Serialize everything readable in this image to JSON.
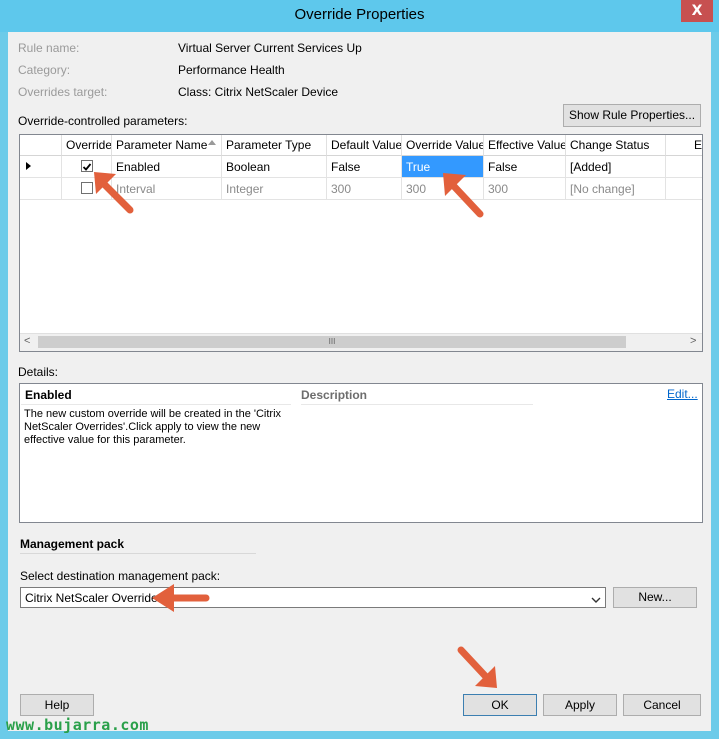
{
  "window": {
    "title": "Override Properties",
    "close_glyph": "X"
  },
  "rule": {
    "rule_name_label": "Rule name:",
    "rule_name_value": "Virtual Server Current Services Up",
    "category_label": "Category:",
    "category_value": "Performance Health",
    "target_label": "Overrides target:",
    "target_value": "Class: Citrix NetScaler Device"
  },
  "params_label": "Override-controlled parameters:",
  "show_rule_props_button": "Show Rule Properties...",
  "grid": {
    "columns": [
      "Override",
      "Parameter Name",
      "Parameter Type",
      "Default Value",
      "Override Value",
      "Effective Value",
      "Change Status",
      "En"
    ],
    "rows": [
      {
        "override_checked": true,
        "name": "Enabled",
        "type": "Boolean",
        "default": "False",
        "override_value": "True",
        "effective": "False",
        "status": "[Added]"
      },
      {
        "override_checked": false,
        "name": "Interval",
        "type": "Integer",
        "default": "300",
        "override_value": "300",
        "effective": "300",
        "status": "[No change]"
      }
    ],
    "scroll_left": "<",
    "scroll_right": ">",
    "scroll_thumb": "III"
  },
  "details": {
    "label": "Details:",
    "header_name": "Enabled",
    "header_description": "Description",
    "edit_link": "Edit...",
    "text": "The new custom override will be created in the 'Citrix NetScaler Overrides'.Click apply to view  the new effective value for this parameter."
  },
  "management_pack": {
    "section_title": "Management pack",
    "select_label": "Select destination management pack:",
    "selected_value": "Citrix NetScaler Overrides",
    "new_button": "New..."
  },
  "buttons": {
    "help": "Help",
    "ok": "OK",
    "apply": "Apply",
    "cancel": "Cancel"
  },
  "watermark": "www.bujarra.com",
  "colors": {
    "titlebar": "#5ec8ec",
    "selection": "#3399ff",
    "arrow": "#e2603c",
    "watermark": "#2aa04a"
  }
}
